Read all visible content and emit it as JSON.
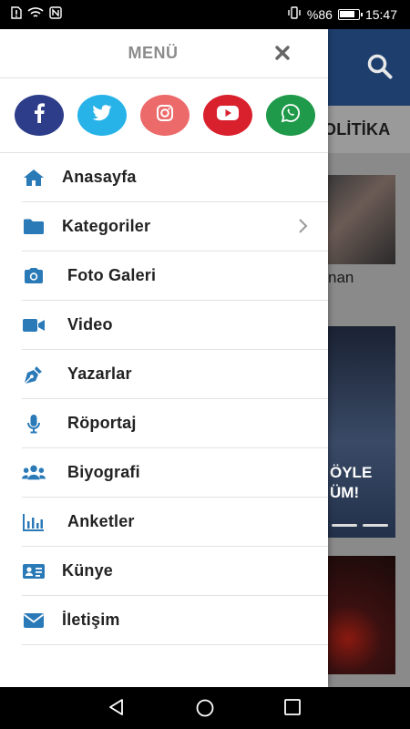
{
  "status_bar": {
    "battery_percent": "%86",
    "time": "15:47",
    "icons": [
      "sim-alert-icon",
      "wifi-icon",
      "nfc-icon",
      "vibrate-icon",
      "battery-icon"
    ]
  },
  "background": {
    "tab_label": "OLİTİKA",
    "article_snippet": "nan",
    "slider_text_line1": "ÖYLE",
    "slider_text_line2": "ÜM!",
    "header_color": "#1e3f6e"
  },
  "drawer": {
    "title": "MENÜ",
    "socials": [
      {
        "name": "facebook",
        "glyph": "f",
        "color": "#2d3d8a"
      },
      {
        "name": "twitter",
        "color": "#27b3e8"
      },
      {
        "name": "instagram",
        "color": "#ec6a6a"
      },
      {
        "name": "youtube",
        "color": "#d9212e"
      },
      {
        "name": "whatsapp",
        "color": "#1e9a4a"
      }
    ],
    "items": [
      {
        "label": "Anasayfa",
        "icon": "home-icon"
      },
      {
        "label": "Kategoriler",
        "icon": "folder-icon",
        "has_submenu": true
      },
      {
        "label": "Foto Galeri",
        "icon": "camera-icon"
      },
      {
        "label": "Video",
        "icon": "video-icon"
      },
      {
        "label": "Yazarlar",
        "icon": "pen-icon"
      },
      {
        "label": "Röportaj",
        "icon": "microphone-icon"
      },
      {
        "label": "Biyografi",
        "icon": "users-icon"
      },
      {
        "label": "Anketler",
        "icon": "poll-chart-icon"
      },
      {
        "label": "Künye",
        "icon": "id-card-icon"
      },
      {
        "label": "İletişim",
        "icon": "envelope-icon"
      }
    ],
    "icon_color": "#2a7ab8"
  }
}
